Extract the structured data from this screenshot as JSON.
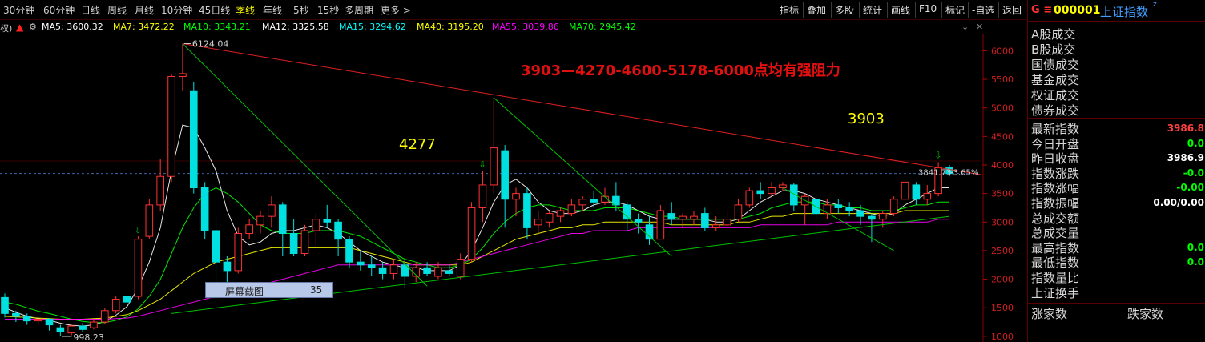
{
  "toolbar": {
    "periods": [
      "30分钟",
      "60分钟",
      "日线",
      "周线",
      "月线",
      "10分钟",
      "45日线",
      "季线",
      "年线",
      "5秒",
      "15秒",
      "多周期",
      "更多 >"
    ],
    "active_period": "季线",
    "tools": [
      "指标",
      "叠加",
      "多股",
      "统计",
      "画线",
      "F10",
      "标记",
      "-自选",
      "返回"
    ]
  },
  "ma_bar": {
    "prefix": "权)",
    "items": [
      {
        "label": "MA5: 3600.32",
        "color": "#ffffff"
      },
      {
        "label": "MA7: 3472.22",
        "color": "#ffff00"
      },
      {
        "label": "MA10: 3343.21",
        "color": "#00ff00"
      },
      {
        "label": "MA12: 3325.58",
        "color": "#ffffff"
      },
      {
        "label": "MA15: 3294.62",
        "color": "#00ffff"
      },
      {
        "label": "MA40: 3195.20",
        "color": "#ffff00"
      },
      {
        "label": "MA55: 3039.86",
        "color": "#ff00ff"
      },
      {
        "label": "MA70: 2945.42",
        "color": "#00ff00"
      }
    ]
  },
  "chart_data": {
    "type": "candlestick",
    "ylim": [
      900,
      6300
    ],
    "y_ticks": [
      1000,
      1500,
      2000,
      2500,
      3000,
      3500,
      4000,
      4500,
      5000,
      5500,
      6000
    ],
    "candles": [
      {
        "o": 1680,
        "c": 1400,
        "h": 1750,
        "l": 1330
      },
      {
        "o": 1400,
        "c": 1350,
        "h": 1450,
        "l": 1250
      },
      {
        "o": 1350,
        "c": 1270,
        "h": 1400,
        "l": 1200
      },
      {
        "o": 1270,
        "c": 1300,
        "h": 1350,
        "l": 1200
      },
      {
        "o": 1300,
        "c": 1200,
        "h": 1320,
        "l": 1100
      },
      {
        "o": 1150,
        "c": 1080,
        "h": 1200,
        "l": 998
      },
      {
        "o": 1060,
        "c": 1180,
        "h": 1220,
        "l": 1020
      },
      {
        "o": 1180,
        "c": 1120,
        "h": 1230,
        "l": 1080
      },
      {
        "o": 1150,
        "c": 1250,
        "h": 1300,
        "l": 1120
      },
      {
        "o": 1250,
        "c": 1450,
        "h": 1500,
        "l": 1220
      },
      {
        "o": 1450,
        "c": 1650,
        "h": 1700,
        "l": 1400
      },
      {
        "o": 1700,
        "c": 1600,
        "h": 1720,
        "l": 1550
      },
      {
        "o": 1700,
        "c": 2700,
        "h": 2750,
        "l": 1650
      },
      {
        "o": 2750,
        "c": 3300,
        "h": 3400,
        "l": 2700
      },
      {
        "o": 3300,
        "c": 3800,
        "h": 4100,
        "l": 3200
      },
      {
        "o": 3800,
        "c": 5550,
        "h": 5600,
        "l": 3700
      },
      {
        "o": 5550,
        "c": 5600,
        "h": 6124,
        "l": 5300
      },
      {
        "o": 5300,
        "c": 3600,
        "h": 5450,
        "l": 3500
      },
      {
        "o": 3600,
        "c": 2850,
        "h": 3700,
        "l": 2700
      },
      {
        "o": 2850,
        "c": 2300,
        "h": 3100,
        "l": 1950
      },
      {
        "o": 2300,
        "c": 2150,
        "h": 2400,
        "l": 1680
      },
      {
        "o": 2150,
        "c": 2800,
        "h": 2900,
        "l": 2100
      },
      {
        "o": 2800,
        "c": 2950,
        "h": 3050,
        "l": 2700
      },
      {
        "o": 2950,
        "c": 3100,
        "h": 3200,
        "l": 2800
      },
      {
        "o": 3100,
        "c": 3300,
        "h": 3450,
        "l": 2900
      },
      {
        "o": 3300,
        "c": 2800,
        "h": 3350,
        "l": 2400
      },
      {
        "o": 2800,
        "c": 2450,
        "h": 3050,
        "l": 2400
      },
      {
        "o": 2450,
        "c": 2850,
        "h": 2950,
        "l": 2400
      },
      {
        "o": 2850,
        "c": 3050,
        "h": 3150,
        "l": 2600
      },
      {
        "o": 3050,
        "c": 3000,
        "h": 3300,
        "l": 2900
      },
      {
        "o": 3000,
        "c": 2700,
        "h": 3050,
        "l": 2400
      },
      {
        "o": 2700,
        "c": 2300,
        "h": 2750,
        "l": 2200
      },
      {
        "o": 2300,
        "c": 2250,
        "h": 2500,
        "l": 2150
      },
      {
        "o": 2250,
        "c": 2200,
        "h": 2400,
        "l": 2050
      },
      {
        "o": 2200,
        "c": 2100,
        "h": 2300,
        "l": 2000
      },
      {
        "o": 2100,
        "c": 2250,
        "h": 2350,
        "l": 2000
      },
      {
        "o": 2250,
        "c": 2050,
        "h": 2350,
        "l": 1850
      },
      {
        "o": 2050,
        "c": 2200,
        "h": 2300,
        "l": 1950
      },
      {
        "o": 2200,
        "c": 2100,
        "h": 2300,
        "l": 2050
      },
      {
        "o": 2050,
        "c": 2200,
        "h": 2300,
        "l": 2000
      },
      {
        "o": 2150,
        "c": 2100,
        "h": 2250,
        "l": 2050
      },
      {
        "o": 2050,
        "c": 2350,
        "h": 2450,
        "l": 2000
      },
      {
        "o": 2350,
        "c": 3250,
        "h": 3350,
        "l": 2300
      },
      {
        "o": 3250,
        "c": 3650,
        "h": 3900,
        "l": 3000
      },
      {
        "o": 3650,
        "c": 4300,
        "h": 5178,
        "l": 3500
      },
      {
        "o": 4250,
        "c": 3400,
        "h": 4350,
        "l": 2900
      },
      {
        "o": 3400,
        "c": 3500,
        "h": 3600,
        "l": 3100
      },
      {
        "o": 3500,
        "c": 2900,
        "h": 3600,
        "l": 2700
      },
      {
        "o": 2950,
        "c": 3050,
        "h": 3200,
        "l": 2800
      },
      {
        "o": 3000,
        "c": 3150,
        "h": 3200,
        "l": 2900
      },
      {
        "o": 3100,
        "c": 3200,
        "h": 3250,
        "l": 3000
      },
      {
        "o": 3150,
        "c": 3300,
        "h": 3400,
        "l": 3100
      },
      {
        "o": 3300,
        "c": 3400,
        "h": 3450,
        "l": 3200
      },
      {
        "o": 3400,
        "c": 3350,
        "h": 3550,
        "l": 3250
      },
      {
        "o": 3350,
        "c": 3450,
        "h": 3600,
        "l": 3300
      },
      {
        "o": 3450,
        "c": 3300,
        "h": 3700,
        "l": 3200
      },
      {
        "o": 3300,
        "c": 3050,
        "h": 3350,
        "l": 2850
      },
      {
        "o": 3050,
        "c": 3000,
        "h": 3150,
        "l": 2800
      },
      {
        "o": 2950,
        "c": 2700,
        "h": 3100,
        "l": 2600
      },
      {
        "o": 2700,
        "c": 3200,
        "h": 3300,
        "l": 2700
      },
      {
        "o": 3150,
        "c": 3050,
        "h": 3350,
        "l": 2950
      },
      {
        "o": 3050,
        "c": 3100,
        "h": 3150,
        "l": 2900
      },
      {
        "o": 3050,
        "c": 3100,
        "h": 3200,
        "l": 2950
      },
      {
        "o": 3150,
        "c": 2900,
        "h": 3250,
        "l": 2850
      },
      {
        "o": 2900,
        "c": 2950,
        "h": 3100,
        "l": 2850
      },
      {
        "o": 2950,
        "c": 3050,
        "h": 3200,
        "l": 2900
      },
      {
        "o": 3050,
        "c": 3300,
        "h": 3400,
        "l": 3000
      },
      {
        "o": 3300,
        "c": 3550,
        "h": 3600,
        "l": 3250
      },
      {
        "o": 3550,
        "c": 3500,
        "h": 3700,
        "l": 3400
      },
      {
        "o": 3500,
        "c": 3600,
        "h": 3700,
        "l": 3450
      },
      {
        "o": 3600,
        "c": 3650,
        "h": 3700,
        "l": 3550
      },
      {
        "o": 3650,
        "c": 3300,
        "h": 3680,
        "l": 3200
      },
      {
        "o": 3300,
        "c": 3450,
        "h": 3500,
        "l": 2950
      },
      {
        "o": 3400,
        "c": 3150,
        "h": 3500,
        "l": 3050
      },
      {
        "o": 3150,
        "c": 3300,
        "h": 3400,
        "l": 3050
      },
      {
        "o": 3300,
        "c": 3250,
        "h": 3400,
        "l": 3150
      },
      {
        "o": 3250,
        "c": 3200,
        "h": 3350,
        "l": 3100
      },
      {
        "o": 3200,
        "c": 3100,
        "h": 3300,
        "l": 2950
      },
      {
        "o": 3100,
        "c": 3050,
        "h": 3150,
        "l": 2650
      },
      {
        "o": 3050,
        "c": 3150,
        "h": 3200,
        "l": 2900
      },
      {
        "o": 3150,
        "c": 3400,
        "h": 3450,
        "l": 3100
      },
      {
        "o": 3400,
        "c": 3700,
        "h": 3750,
        "l": 3200
      },
      {
        "o": 3650,
        "c": 3400,
        "h": 3700,
        "l": 3300
      },
      {
        "o": 3400,
        "c": 3500,
        "h": 3650,
        "l": 3300
      },
      {
        "o": 3500,
        "c": 3950,
        "h": 4050,
        "l": 3450
      },
      {
        "o": 3950,
        "c": 3850,
        "h": 4000,
        "l": 3800
      }
    ],
    "ma_lines": [
      {
        "name": "MA5",
        "color": "#ffffff",
        "values": [
          1500,
          1420,
          1350,
          1310,
          1280,
          1230,
          1190,
          1180,
          1200,
          1260,
          1370,
          1520,
          1850,
          2300,
          2900,
          3900,
          4700,
          4650,
          4300,
          3900,
          3200,
          2750,
          2600,
          2650,
          2800,
          2850,
          2850,
          2900,
          2950,
          2900,
          2800,
          2650,
          2500,
          2400,
          2300,
          2250,
          2200,
          2200,
          2150,
          2150,
          2150,
          2250,
          2500,
          2900,
          3350,
          3650,
          3750,
          3600,
          3350,
          3200,
          3150,
          3150,
          3200,
          3300,
          3350,
          3350,
          3300,
          3200,
          3100,
          3050,
          3050,
          3050,
          3050,
          3050,
          3000,
          3000,
          3050,
          3200,
          3350,
          3450,
          3550,
          3550,
          3500,
          3400,
          3350,
          3300,
          3250,
          3200,
          3150,
          3100,
          3150,
          3300,
          3400,
          3500,
          3600,
          3600
        ]
      },
      {
        "name": "MA10",
        "color": "#00ff00",
        "values": [
          1600,
          1560,
          1500,
          1440,
          1400,
          1350,
          1300,
          1260,
          1240,
          1240,
          1280,
          1340,
          1480,
          1700,
          2000,
          2450,
          2900,
          3250,
          3500,
          3600,
          3500,
          3350,
          3150,
          2950,
          2850,
          2800,
          2800,
          2800,
          2850,
          2850,
          2850,
          2800,
          2750,
          2650,
          2550,
          2450,
          2350,
          2300,
          2250,
          2200,
          2200,
          2250,
          2350,
          2550,
          2800,
          3000,
          3150,
          3250,
          3300,
          3300,
          3250,
          3200,
          3200,
          3200,
          3250,
          3250,
          3250,
          3200,
          3150,
          3100,
          3100,
          3050,
          3050,
          3050,
          3050,
          3050,
          3050,
          3100,
          3150,
          3250,
          3300,
          3350,
          3350,
          3350,
          3300,
          3300,
          3250,
          3250,
          3200,
          3200,
          3200,
          3250,
          3300,
          3300,
          3350,
          3350
        ]
      },
      {
        "name": "MA40",
        "color": "#ffff00",
        "values": [
          1350,
          1340,
          1330,
          1320,
          1310,
          1300,
          1300,
          1300,
          1310,
          1320,
          1350,
          1380,
          1450,
          1550,
          1650,
          1800,
          1950,
          2100,
          2200,
          2300,
          2350,
          2400,
          2450,
          2500,
          2550,
          2550,
          2550,
          2550,
          2550,
          2550,
          2550,
          2550,
          2500,
          2450,
          2400,
          2350,
          2300,
          2250,
          2250,
          2250,
          2250,
          2250,
          2300,
          2400,
          2500,
          2600,
          2700,
          2750,
          2800,
          2850,
          2900,
          2900,
          2950,
          2950,
          3000,
          3000,
          3000,
          3000,
          3000,
          3000,
          2950,
          2950,
          2950,
          2950,
          2950,
          2950,
          3000,
          3000,
          3050,
          3100,
          3100,
          3150,
          3150,
          3150,
          3150,
          3150,
          3150,
          3150,
          3150,
          3150,
          3150,
          3200,
          3200,
          3200,
          3200,
          3200
        ]
      },
      {
        "name": "MA55",
        "color": "#ff00ff",
        "values": [
          1300,
          1300,
          1300,
          1300,
          1300,
          1300,
          1300,
          1300,
          1300,
          1300,
          1310,
          1320,
          1350,
          1400,
          1450,
          1500,
          1550,
          1600,
          1650,
          1700,
          1750,
          1800,
          1850,
          1900,
          1950,
          2000,
          2050,
          2100,
          2150,
          2200,
          2250,
          2250,
          2250,
          2250,
          2250,
          2250,
          2250,
          2250,
          2250,
          2250,
          2250,
          2300,
          2350,
          2400,
          2450,
          2500,
          2550,
          2600,
          2650,
          2700,
          2750,
          2800,
          2800,
          2850,
          2850,
          2850,
          2850,
          2900,
          2900,
          2900,
          2900,
          2900,
          2900,
          2900,
          2900,
          2900,
          2900,
          2900,
          2950,
          2950,
          2950,
          2950,
          2950,
          2950,
          2950,
          3000,
          3000,
          3000,
          3000,
          3000,
          3000,
          3000,
          3000,
          3000,
          3050,
          3050
        ]
      }
    ],
    "highs_label": {
      "value": "6124.04"
    },
    "lows_label": {
      "value": "998.23"
    },
    "current_label": {
      "value": "3841.73",
      "pct": "-3.65%"
    },
    "annotation_main": "3903—4270-4600-5178-6000点均有强阻力",
    "annotation_4277": "4277",
    "annotation_3903": "3903",
    "ref_level": 3850
  },
  "watermark": {
    "label": "屏幕截图",
    "count": "35"
  },
  "panel": {
    "header_prefix": "G ≡",
    "code": "000001",
    "name": "上证指数",
    "name_sup": "z",
    "rows_top": [
      "A股成交",
      "B股成交",
      "国债成交",
      "基金成交",
      "权证成交",
      "债券成交"
    ],
    "rows_stats": [
      {
        "label": "最新指数",
        "value": "3986.8",
        "color": "#ff4040"
      },
      {
        "label": "今日开盘",
        "value": "0.0",
        "color": "#00ff00"
      },
      {
        "label": "昨日收盘",
        "value": "3986.9",
        "color": "#ffffff"
      },
      {
        "label": "指数涨跌",
        "value": "-0.0",
        "color": "#00ff00"
      },
      {
        "label": "指数涨幅",
        "value": "-0.00",
        "color": "#00ff00"
      },
      {
        "label": "指数振幅",
        "value": "0.00/0.00",
        "color": "#ffffff"
      },
      {
        "label": "总成交额",
        "value": "",
        "color": "#ffffff"
      },
      {
        "label": "总成交量",
        "value": "",
        "color": "#ffffff"
      },
      {
        "label": "最高指数",
        "value": "0.0",
        "color": "#00ff00"
      },
      {
        "label": "最低指数",
        "value": "0.0",
        "color": "#00ff00"
      },
      {
        "label": "指数量比",
        "value": "",
        "color": "#ffffff"
      },
      {
        "label": "上证换手",
        "value": "",
        "color": "#ffffff"
      }
    ],
    "footer_left": "涨家数",
    "footer_right": "跌家数"
  }
}
